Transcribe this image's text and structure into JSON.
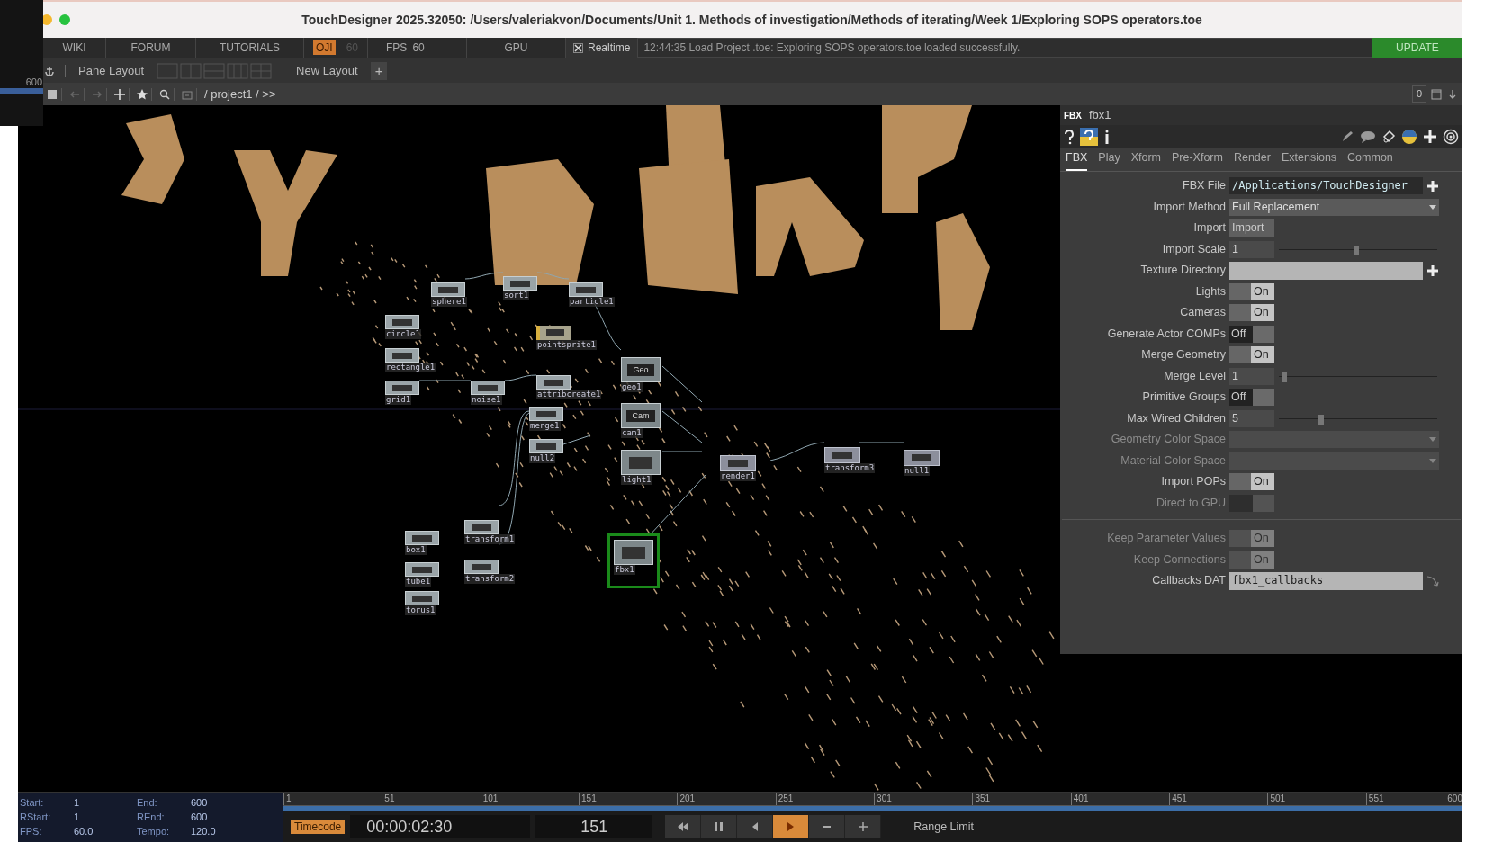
{
  "window": {
    "title": "TouchDesigner 2025.32050: /Users/valeriakvon/Documents/Unit 1. Methods of investigation/Methods of iterating/Week 1/Exploring SOPS operators.toe"
  },
  "side_panel": {
    "value": "600"
  },
  "menu_bar": {
    "items": [
      "WIKI",
      "FORUM",
      "TUTORIALS"
    ],
    "perform_badge": "OJI",
    "perform_fps": "60",
    "fps_label": "FPS",
    "fps_value": "60",
    "gpu": "GPU",
    "realtime": {
      "label": "Realtime",
      "checked": true
    },
    "status_message": "12:44:35 Load Project .toe: Exploring SOPS operators.toe loaded successfully.",
    "update_button": "UPDATE"
  },
  "layout_bar": {
    "pane_layout": "Pane Layout",
    "new_layout": "New Layout",
    "add": "+"
  },
  "path_bar": {
    "path": "/ project1 / >>",
    "pane_index": "0"
  },
  "network": {
    "nodes": [
      {
        "label": "sphere1",
        "kind": "sop",
        "selected": false
      },
      {
        "label": "sort1",
        "kind": "sop",
        "selected": false
      },
      {
        "label": "particle1",
        "kind": "sop",
        "selected": false
      },
      {
        "label": "circle1",
        "kind": "sop",
        "selected": false
      },
      {
        "label": "pointsprite1",
        "kind": "mat",
        "selected": false
      },
      {
        "label": "rectangle1",
        "kind": "sop",
        "selected": false
      },
      {
        "label": "grid1",
        "kind": "sop",
        "selected": false
      },
      {
        "label": "noise1",
        "kind": "sop",
        "selected": false
      },
      {
        "label": "attribcreate1",
        "kind": "sop",
        "selected": false
      },
      {
        "label": "geo1",
        "kind": "comp",
        "icon_text": "Geo",
        "selected": false
      },
      {
        "label": "merge1",
        "kind": "sop",
        "selected": false
      },
      {
        "label": "cam1",
        "kind": "comp",
        "icon_text": "Cam",
        "selected": false
      },
      {
        "label": "null2",
        "kind": "sop",
        "selected": false
      },
      {
        "label": "light1",
        "kind": "comp",
        "selected": false
      },
      {
        "label": "render1",
        "kind": "top",
        "selected": false
      },
      {
        "label": "transform3",
        "kind": "top",
        "selected": false
      },
      {
        "label": "null1",
        "kind": "top",
        "selected": false
      },
      {
        "label": "box1",
        "kind": "sop",
        "selected": false
      },
      {
        "label": "transform1",
        "kind": "sop",
        "selected": false
      },
      {
        "label": "tube1",
        "kind": "sop",
        "selected": false
      },
      {
        "label": "transform2",
        "kind": "sop",
        "selected": false
      },
      {
        "label": "torus1",
        "kind": "sop",
        "selected": false
      },
      {
        "label": "fbx1",
        "kind": "comp",
        "selected": true
      }
    ]
  },
  "parameters": {
    "op_type": "FBX",
    "op_name": "fbx1",
    "tabs": [
      {
        "label": "FBX",
        "selected": true
      },
      {
        "label": "Play",
        "selected": false
      },
      {
        "label": "Xform",
        "selected": false
      },
      {
        "label": "Pre-Xform",
        "selected": false
      },
      {
        "label": "Render",
        "selected": false
      },
      {
        "label": "Extensions",
        "selected": false
      },
      {
        "label": "Common",
        "selected": false
      }
    ],
    "rows": [
      {
        "kind": "file",
        "label": "FBX File",
        "value": "/Applications/TouchDesigner",
        "disabled": false
      },
      {
        "kind": "menu",
        "label": "Import Method",
        "value": "Full Replacement",
        "disabled": false
      },
      {
        "kind": "pulse",
        "label": "Import",
        "value": "Import",
        "disabled": false
      },
      {
        "kind": "slider",
        "label": "Import Scale",
        "value": "1",
        "level": 0.49,
        "disabled": false
      },
      {
        "kind": "text",
        "label": "Texture Directory",
        "add_button": true,
        "disabled": false
      },
      {
        "kind": "toggle",
        "label": "Lights",
        "value": "On",
        "on": true,
        "disabled": false
      },
      {
        "kind": "toggle",
        "label": "Cameras",
        "value": "On",
        "on": true,
        "disabled": false
      },
      {
        "kind": "toggle",
        "label": "Generate Actor COMPs",
        "value": "Off",
        "on": false,
        "disabled": false
      },
      {
        "kind": "toggle",
        "label": "Merge Geometry",
        "value": "On",
        "on": true,
        "disabled": false
      },
      {
        "kind": "slider",
        "label": "Merge Level",
        "value": "1",
        "level": 0.02,
        "disabled": false
      },
      {
        "kind": "toggle",
        "label": "Primitive Groups",
        "value": "Off",
        "on": false,
        "disabled": false
      },
      {
        "kind": "slider",
        "label": "Max Wired Children",
        "value": "5",
        "level": 0.26,
        "disabled": false
      },
      {
        "kind": "menu",
        "label": "Geometry Color Space",
        "disabled": true
      },
      {
        "kind": "menu",
        "label": "Material Color Space",
        "disabled": true
      },
      {
        "kind": "toggle",
        "label": "Import POPs",
        "value": "On",
        "on": true,
        "disabled": false
      },
      {
        "kind": "toggle",
        "label": "Direct to GPU",
        "on": false,
        "disabled": true
      },
      {
        "kind": "separator"
      },
      {
        "kind": "toggle",
        "label": "Keep Parameter Values",
        "value": "On",
        "on": true,
        "disabled": true
      },
      {
        "kind": "toggle",
        "label": "Keep Connections",
        "value": "On",
        "on": true,
        "disabled": true
      },
      {
        "kind": "text",
        "label": "Callbacks DAT",
        "value": "fbx1_callbacks",
        "link_arrow": true,
        "disabled": false
      }
    ]
  },
  "timeline": {
    "info": [
      {
        "label": "Start:",
        "value": "1"
      },
      {
        "label": "End:",
        "value": "600"
      },
      {
        "label": "RStart:",
        "value": "1"
      },
      {
        "label": "REnd:",
        "value": "600"
      },
      {
        "label": "FPS:",
        "value": "60.0"
      },
      {
        "label": "Tempo:",
        "value": "120.0"
      }
    ],
    "ticks": [
      "1",
      "51",
      "101",
      "151",
      "201",
      "251",
      "301",
      "351",
      "401",
      "451",
      "501",
      "551",
      "600"
    ],
    "timecode_button": "Timecode",
    "timecode": "00:00:02:30",
    "frame": "151",
    "transport": [
      {
        "kind": "rewind",
        "selected": false
      },
      {
        "kind": "pause",
        "selected": false
      },
      {
        "kind": "back",
        "selected": false
      },
      {
        "kind": "play",
        "selected": true
      },
      {
        "kind": "minus",
        "selected": false
      },
      {
        "kind": "plus",
        "selected": false
      }
    ],
    "range_limit": "Range Limit"
  }
}
